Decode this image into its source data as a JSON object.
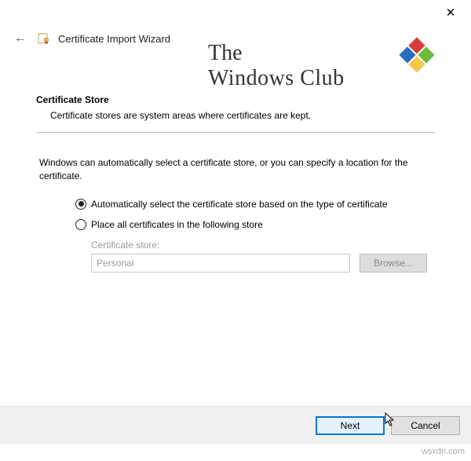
{
  "window": {
    "title": "Certificate Import Wizard"
  },
  "watermark": {
    "line1": "The",
    "line2": "Windows Club"
  },
  "section": {
    "title": "Certificate Store",
    "description": "Certificate stores are system areas where certificates are kept."
  },
  "instruction": "Windows can automatically select a certificate store, or you can specify a location for the certificate.",
  "options": {
    "auto": "Automatically select the certificate store based on the type of certificate",
    "manual": "Place all certificates in the following store"
  },
  "store": {
    "label": "Certificate store:",
    "value": "Personal",
    "browse": "Browse..."
  },
  "buttons": {
    "next": "Next",
    "cancel": "Cancel"
  },
  "attribution": "wsxdn.com"
}
